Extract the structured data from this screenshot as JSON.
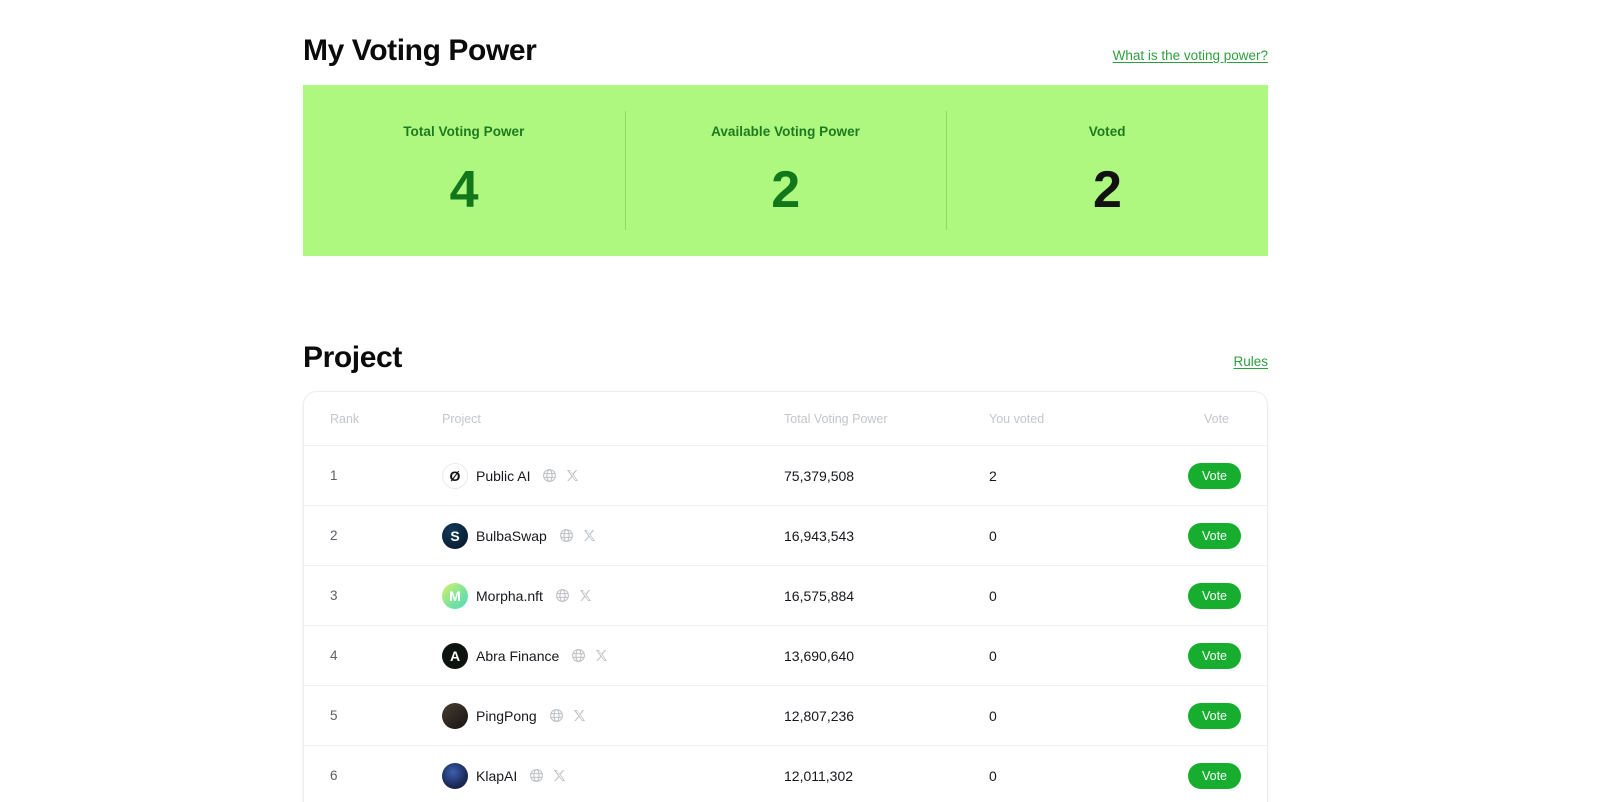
{
  "voting_power": {
    "title": "My Voting Power",
    "help_link": "What is the voting power?",
    "stats": [
      {
        "label": "Total Voting Power",
        "value": "4",
        "tone": "green"
      },
      {
        "label": "Available Voting Power",
        "value": "2",
        "tone": "green"
      },
      {
        "label": "Voted",
        "value": "2",
        "tone": "dark"
      }
    ]
  },
  "project_section": {
    "title": "Project",
    "rules_link": "Rules",
    "table": {
      "columns": {
        "rank": "Rank",
        "project": "Project",
        "total_voting_power": "Total Voting Power",
        "you_voted": "You voted",
        "vote": "Vote"
      },
      "vote_button_label": "Vote",
      "website_icon": "globe-icon",
      "social_icon": "x-twitter-icon",
      "rows": [
        {
          "rank": "1",
          "name": "Public AI",
          "avatar": "av-publicai",
          "avatar_glyph": "Ø",
          "total_voting_power": "75,379,508",
          "you_voted": "2",
          "vote_label": "Vote"
        },
        {
          "rank": "2",
          "name": "BulbaSwap",
          "avatar": "av-bulba",
          "avatar_glyph": "S",
          "total_voting_power": "16,943,543",
          "you_voted": "0",
          "vote_label": "Vote"
        },
        {
          "rank": "3",
          "name": "Morpha.nft",
          "avatar": "av-morpha",
          "avatar_glyph": "M",
          "total_voting_power": "16,575,884",
          "you_voted": "0",
          "vote_label": "Vote"
        },
        {
          "rank": "4",
          "name": "Abra Finance",
          "avatar": "av-abra",
          "avatar_glyph": "A",
          "total_voting_power": "13,690,640",
          "you_voted": "0",
          "vote_label": "Vote"
        },
        {
          "rank": "5",
          "name": "PingPong",
          "avatar": "av-ping",
          "avatar_glyph": "",
          "total_voting_power": "12,807,236",
          "you_voted": "0",
          "vote_label": "Vote"
        },
        {
          "rank": "6",
          "name": "KlapAI",
          "avatar": "av-klap",
          "avatar_glyph": "",
          "total_voting_power": "12,011,302",
          "you_voted": "0",
          "vote_label": "Vote"
        }
      ]
    }
  },
  "colors": {
    "panel_green": "#aff87f",
    "accent_green": "#17ae2f",
    "link_green": "#2e9e3e",
    "stat_green": "#12761a",
    "label_green": "#1d7a20"
  }
}
